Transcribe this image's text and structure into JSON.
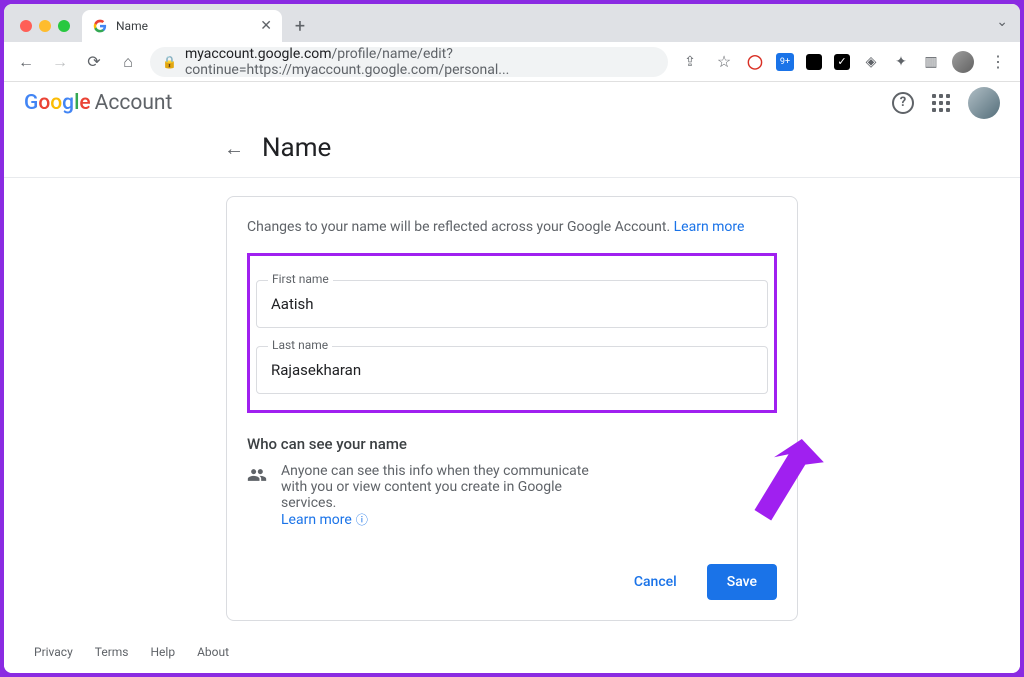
{
  "browser": {
    "tab_title": "Name",
    "url_domain": "myaccount.google.com",
    "url_path": "/profile/name/edit?continue=https://myaccount.google.com/personal..."
  },
  "header": {
    "logo_account_text": "Account"
  },
  "page": {
    "title": "Name",
    "notice_text": "Changes to your name will be reflected across your Google Account. ",
    "notice_link": "Learn more",
    "first_name_label": "First name",
    "first_name_value": "Aatish",
    "last_name_label": "Last name",
    "last_name_value": "Rajasekharan",
    "visibility_title": "Who can see your name",
    "visibility_text": "Anyone can see this info when they communicate with you or view content you create in Google services.",
    "visibility_learn_more": "Learn more",
    "cancel_label": "Cancel",
    "save_label": "Save"
  },
  "footer": {
    "privacy": "Privacy",
    "terms": "Terms",
    "help": "Help",
    "about": "About"
  }
}
